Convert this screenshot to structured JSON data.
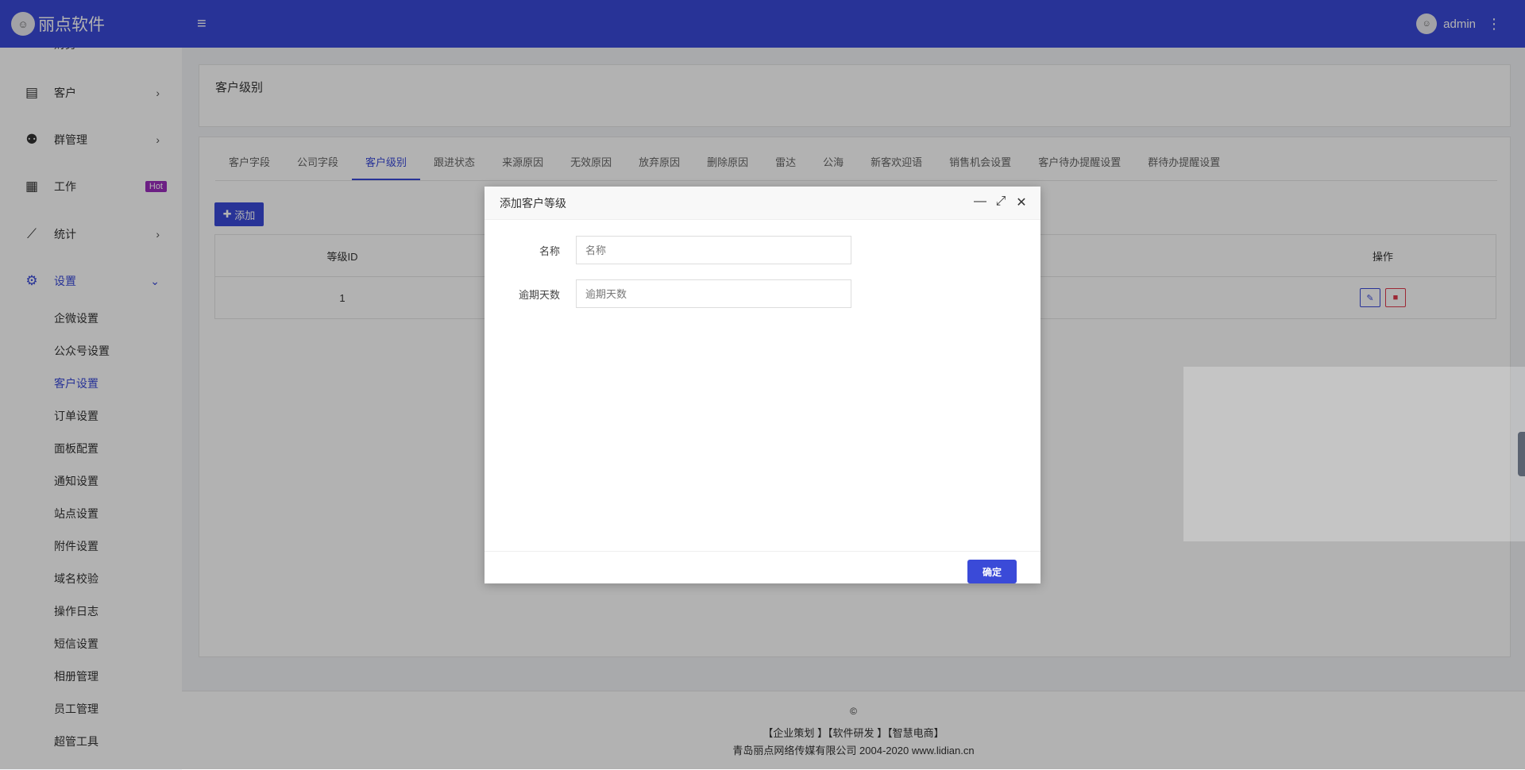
{
  "header": {
    "brand": "丽点软件",
    "user": "admin"
  },
  "sidebar": {
    "items": [
      {
        "label": "财务",
        "icon": "finance-icon"
      },
      {
        "label": "客户",
        "icon": "contact-card-icon"
      },
      {
        "label": "群管理",
        "icon": "group-icon"
      },
      {
        "label": "工作",
        "icon": "grid-icon",
        "badge": "Hot"
      },
      {
        "label": "统计",
        "icon": "chart-line-icon"
      },
      {
        "label": "设置",
        "icon": "gear-icon"
      }
    ],
    "sub_items": [
      "企微设置",
      "公众号设置",
      "客户设置",
      "订单设置",
      "面板配置",
      "通知设置",
      "站点设置",
      "附件设置",
      "域名校验",
      "操作日志",
      "短信设置",
      "相册管理",
      "员工管理",
      "超管工具"
    ]
  },
  "page": {
    "title": "客户级别",
    "tabs": [
      "客户字段",
      "公司字段",
      "客户级别",
      "跟进状态",
      "来源原因",
      "无效原因",
      "放弃原因",
      "删除原因",
      "雷达",
      "公海",
      "新客欢迎语",
      "销售机会设置",
      "客户待办提醒设置",
      "群待办提醒设置"
    ],
    "add_label": "添加",
    "table": {
      "headers": [
        "等级ID",
        "",
        "操作"
      ],
      "rows": [
        [
          "1",
          "",
          ""
        ]
      ]
    }
  },
  "footer": {
    "copyright": "©",
    "links": "【企业策划 】【软件研发 】【智慧电商】",
    "company": "青岛丽点网络传媒有限公司 2004-2020 www.lidian.cn"
  },
  "dialog": {
    "title": "添加客户等级",
    "fields": [
      {
        "label": "名称",
        "placeholder": "名称",
        "value": ""
      },
      {
        "label": "逾期天数",
        "placeholder": "逾期天数",
        "value": ""
      }
    ],
    "ok_label": "确定"
  },
  "colors": {
    "primary": "#3a4ad8",
    "hot_badge": "#9b2dbe",
    "danger": "#e03a4c"
  }
}
